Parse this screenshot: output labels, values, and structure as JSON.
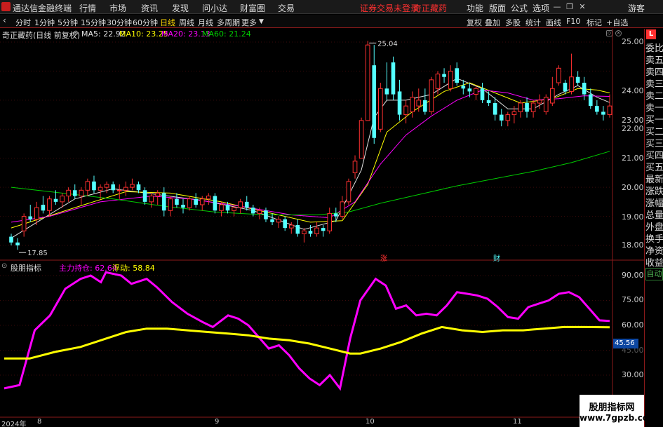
{
  "menubar": {
    "app_title": "通达信金融终端",
    "items": [
      "行情",
      "市场",
      "资讯",
      "发现",
      "问小达",
      "财富圈",
      "交易"
    ],
    "notice": "证券交易未登录",
    "stock_link": "奇正藏药",
    "right_items": [
      "功能",
      "版面",
      "公式",
      "选项"
    ],
    "user": "游客"
  },
  "toolbar": {
    "periods": [
      "分时",
      "1分钟",
      "5分钟",
      "15分钟",
      "30分钟",
      "60分钟",
      "日线",
      "周线",
      "月线",
      "多周期",
      "更多"
    ],
    "active_period": "日线",
    "right_items": [
      "复权",
      "叠加",
      "多股",
      "统计",
      "画线",
      "F10",
      "标记",
      "+自选"
    ]
  },
  "price_chart": {
    "stock_name": "奇正藏药(日线 前复权)",
    "ma5": "MA5: 22.92",
    "ma10": "MA10: 23.25",
    "ma20": "MA20: 23.13",
    "ma60": "MA60: 21.24",
    "high_label": "25.04",
    "low_label": "17.85",
    "axis_ticks": [
      "25.00",
      "24.00",
      "23.00",
      "22.00",
      "21.00",
      "20.00",
      "19.00",
      "18.00"
    ],
    "event_up": "涨",
    "event_fin": "财"
  },
  "indicator": {
    "name": "股朋指标",
    "main_label": "主力持仓: 62.64",
    "float_label": "浮动: 58.84",
    "axis_ticks": [
      "90.00",
      "75.00",
      "60.00",
      "45.00",
      "30.00"
    ],
    "current_value": "45.56"
  },
  "date_axis": [
    "2024年",
    "8",
    "9",
    "10",
    "11"
  ],
  "side_panel": {
    "badge": "L",
    "items": [
      "委比",
      "卖五",
      "卖四",
      "卖三",
      "卖二",
      "卖一",
      "买一",
      "买二",
      "买三",
      "买四",
      "买五",
      "最新",
      "涨跌",
      "涨幅",
      "总量",
      "外盘",
      "换手",
      "净资",
      "收益"
    ],
    "auto_label": "自动"
  },
  "watermark": {
    "line1": "股朋指标网",
    "line2": "www.7gpzb.com"
  },
  "colors": {
    "up": "#ff3030",
    "down": "#54ffff",
    "ma5": "#e0e0e0",
    "ma10": "#ffff00",
    "ma20": "#ff00ff",
    "ma60": "#00cc00",
    "main_line": "#ff00ff",
    "float_line": "#ffff00"
  },
  "chart_data": {
    "type": "candlestick",
    "price_axis": {
      "ylim": [
        17.7,
        25.25
      ]
    },
    "candles": [
      {
        "o": 18.3,
        "h": 18.4,
        "l": 18.0,
        "c": 18.1
      },
      {
        "o": 18.1,
        "h": 18.25,
        "l": 17.85,
        "c": 18.0
      },
      {
        "o": 18.5,
        "h": 19.1,
        "l": 18.3,
        "c": 19.0
      },
      {
        "o": 19.0,
        "h": 19.4,
        "l": 18.8,
        "c": 18.9
      },
      {
        "o": 18.9,
        "h": 19.5,
        "l": 18.7,
        "c": 19.3
      },
      {
        "o": 19.4,
        "h": 19.7,
        "l": 19.1,
        "c": 19.2
      },
      {
        "o": 19.2,
        "h": 19.7,
        "l": 19.0,
        "c": 19.6
      },
      {
        "o": 19.6,
        "h": 19.9,
        "l": 19.4,
        "c": 19.5
      },
      {
        "o": 19.5,
        "h": 19.8,
        "l": 19.3,
        "c": 19.7
      },
      {
        "o": 19.7,
        "h": 20.0,
        "l": 19.5,
        "c": 19.9
      },
      {
        "o": 19.9,
        "h": 20.1,
        "l": 19.6,
        "c": 19.7
      },
      {
        "o": 19.7,
        "h": 20.0,
        "l": 19.4,
        "c": 19.9
      },
      {
        "o": 19.9,
        "h": 20.3,
        "l": 19.7,
        "c": 20.2
      },
      {
        "o": 20.2,
        "h": 20.4,
        "l": 19.8,
        "c": 19.9
      },
      {
        "o": 19.9,
        "h": 20.1,
        "l": 19.6,
        "c": 20.0
      },
      {
        "o": 20.0,
        "h": 20.2,
        "l": 19.8,
        "c": 20.1
      },
      {
        "o": 20.1,
        "h": 20.2,
        "l": 19.8,
        "c": 19.9
      },
      {
        "o": 19.9,
        "h": 20.1,
        "l": 19.6,
        "c": 19.9
      },
      {
        "o": 19.9,
        "h": 20.2,
        "l": 19.7,
        "c": 20.0
      },
      {
        "o": 20.0,
        "h": 20.3,
        "l": 19.9,
        "c": 20.1
      },
      {
        "o": 20.1,
        "h": 20.2,
        "l": 19.8,
        "c": 19.9
      },
      {
        "o": 19.9,
        "h": 20.0,
        "l": 19.4,
        "c": 19.5
      },
      {
        "o": 19.5,
        "h": 19.8,
        "l": 19.3,
        "c": 19.7
      },
      {
        "o": 19.7,
        "h": 19.9,
        "l": 19.4,
        "c": 19.8
      },
      {
        "o": 19.8,
        "h": 20.0,
        "l": 19.0,
        "c": 19.2
      },
      {
        "o": 19.2,
        "h": 19.7,
        "l": 19.0,
        "c": 19.6
      },
      {
        "o": 19.6,
        "h": 19.8,
        "l": 19.3,
        "c": 19.4
      },
      {
        "o": 19.4,
        "h": 19.6,
        "l": 19.1,
        "c": 19.3
      },
      {
        "o": 19.3,
        "h": 19.7,
        "l": 19.2,
        "c": 19.6
      },
      {
        "o": 19.6,
        "h": 19.8,
        "l": 19.3,
        "c": 19.4
      },
      {
        "o": 19.4,
        "h": 19.7,
        "l": 19.2,
        "c": 19.6
      },
      {
        "o": 19.6,
        "h": 19.8,
        "l": 19.4,
        "c": 19.7
      },
      {
        "o": 19.7,
        "h": 19.8,
        "l": 19.1,
        "c": 19.2
      },
      {
        "o": 19.2,
        "h": 19.5,
        "l": 19.0,
        "c": 19.4
      },
      {
        "o": 19.4,
        "h": 19.5,
        "l": 19.1,
        "c": 19.2
      },
      {
        "o": 19.2,
        "h": 19.4,
        "l": 19.0,
        "c": 19.3
      },
      {
        "o": 19.3,
        "h": 19.6,
        "l": 19.1,
        "c": 19.5
      },
      {
        "o": 19.5,
        "h": 19.7,
        "l": 19.2,
        "c": 19.3
      },
      {
        "o": 19.3,
        "h": 19.4,
        "l": 19.0,
        "c": 19.1
      },
      {
        "o": 19.1,
        "h": 19.3,
        "l": 18.9,
        "c": 19.2
      },
      {
        "o": 19.2,
        "h": 19.3,
        "l": 18.8,
        "c": 18.9
      },
      {
        "o": 18.9,
        "h": 19.1,
        "l": 18.7,
        "c": 18.8
      },
      {
        "o": 18.8,
        "h": 19.0,
        "l": 18.6,
        "c": 18.9
      },
      {
        "o": 18.9,
        "h": 19.0,
        "l": 18.5,
        "c": 18.6
      },
      {
        "o": 18.6,
        "h": 18.8,
        "l": 18.4,
        "c": 18.7
      },
      {
        "o": 18.7,
        "h": 18.9,
        "l": 18.3,
        "c": 18.4
      },
      {
        "o": 18.4,
        "h": 18.6,
        "l": 18.1,
        "c": 18.5
      },
      {
        "o": 18.5,
        "h": 18.7,
        "l": 18.3,
        "c": 18.4
      },
      {
        "o": 18.4,
        "h": 18.8,
        "l": 18.3,
        "c": 18.6
      },
      {
        "o": 18.6,
        "h": 18.7,
        "l": 18.3,
        "c": 18.5
      },
      {
        "o": 18.5,
        "h": 19.3,
        "l": 18.4,
        "c": 19.1
      },
      {
        "o": 19.1,
        "h": 19.3,
        "l": 18.8,
        "c": 19.0
      },
      {
        "o": 19.0,
        "h": 19.7,
        "l": 18.9,
        "c": 19.5
      },
      {
        "o": 19.5,
        "h": 20.3,
        "l": 19.4,
        "c": 20.2
      },
      {
        "o": 20.5,
        "h": 21.1,
        "l": 20.3,
        "c": 20.9
      },
      {
        "o": 21.0,
        "h": 22.4,
        "l": 21.0,
        "c": 22.3
      },
      {
        "o": 22.3,
        "h": 25.04,
        "l": 22.3,
        "c": 24.9
      },
      {
        "o": 24.2,
        "h": 24.9,
        "l": 21.5,
        "c": 21.7
      },
      {
        "o": 22.0,
        "h": 23.6,
        "l": 21.9,
        "c": 23.4
      },
      {
        "o": 23.4,
        "h": 24.3,
        "l": 23.0,
        "c": 23.2
      },
      {
        "o": 24.3,
        "h": 24.5,
        "l": 23.0,
        "c": 23.2
      },
      {
        "o": 23.3,
        "h": 23.7,
        "l": 22.3,
        "c": 22.5
      },
      {
        "o": 22.5,
        "h": 23.0,
        "l": 22.2,
        "c": 22.8
      },
      {
        "o": 22.6,
        "h": 23.3,
        "l": 22.4,
        "c": 23.1
      },
      {
        "o": 22.8,
        "h": 23.4,
        "l": 22.6,
        "c": 23.0
      },
      {
        "o": 23.0,
        "h": 23.4,
        "l": 22.5,
        "c": 22.6
      },
      {
        "o": 22.6,
        "h": 23.8,
        "l": 22.5,
        "c": 23.7
      },
      {
        "o": 23.4,
        "h": 24.0,
        "l": 23.2,
        "c": 23.9
      },
      {
        "o": 23.9,
        "h": 24.1,
        "l": 23.6,
        "c": 23.8
      },
      {
        "o": 23.4,
        "h": 24.2,
        "l": 23.3,
        "c": 24.0
      },
      {
        "o": 24.1,
        "h": 24.3,
        "l": 23.5,
        "c": 23.6
      },
      {
        "o": 23.5,
        "h": 23.7,
        "l": 23.2,
        "c": 23.4
      },
      {
        "o": 23.4,
        "h": 23.6,
        "l": 23.1,
        "c": 23.3
      },
      {
        "o": 23.2,
        "h": 23.5,
        "l": 23.0,
        "c": 23.4
      },
      {
        "o": 23.4,
        "h": 23.6,
        "l": 22.9,
        "c": 23.0
      },
      {
        "o": 23.0,
        "h": 23.3,
        "l": 22.8,
        "c": 22.9
      },
      {
        "o": 22.9,
        "h": 23.1,
        "l": 22.3,
        "c": 22.5
      },
      {
        "o": 22.5,
        "h": 22.7,
        "l": 22.1,
        "c": 22.3
      },
      {
        "o": 22.3,
        "h": 22.6,
        "l": 22.1,
        "c": 22.5
      },
      {
        "o": 22.5,
        "h": 22.8,
        "l": 22.2,
        "c": 22.6
      },
      {
        "o": 22.6,
        "h": 23.0,
        "l": 22.4,
        "c": 22.9
      },
      {
        "o": 22.9,
        "h": 23.1,
        "l": 22.4,
        "c": 22.6
      },
      {
        "o": 22.6,
        "h": 23.0,
        "l": 22.4,
        "c": 22.9
      },
      {
        "o": 22.9,
        "h": 23.2,
        "l": 22.7,
        "c": 23.0
      },
      {
        "o": 22.6,
        "h": 23.2,
        "l": 22.5,
        "c": 23.1
      },
      {
        "o": 22.9,
        "h": 23.8,
        "l": 22.8,
        "c": 23.4
      },
      {
        "o": 23.6,
        "h": 24.2,
        "l": 23.5,
        "c": 24.1
      },
      {
        "o": 23.6,
        "h": 23.7,
        "l": 23.2,
        "c": 23.3
      },
      {
        "o": 23.3,
        "h": 24.6,
        "l": 23.2,
        "c": 23.8
      },
      {
        "o": 23.8,
        "h": 24.0,
        "l": 23.5,
        "c": 23.6
      },
      {
        "o": 23.6,
        "h": 23.8,
        "l": 23.0,
        "c": 23.2
      },
      {
        "o": 23.2,
        "h": 23.4,
        "l": 22.7,
        "c": 22.8
      },
      {
        "o": 22.8,
        "h": 23.0,
        "l": 22.5,
        "c": 22.6
      },
      {
        "o": 22.6,
        "h": 22.8,
        "l": 22.3,
        "c": 22.5
      },
      {
        "o": 22.5,
        "h": 23.2,
        "l": 22.4,
        "c": 22.8
      }
    ],
    "ma": {
      "ma5": [
        [
          0,
          18.25
        ],
        [
          10,
          19.6
        ],
        [
          16,
          19.95
        ],
        [
          23,
          19.75
        ],
        [
          30,
          19.55
        ],
        [
          38,
          19.2
        ],
        [
          46,
          18.55
        ],
        [
          51,
          18.85
        ],
        [
          55,
          20.6
        ],
        [
          57,
          22.4
        ],
        [
          59,
          23.0
        ],
        [
          62,
          23.0
        ],
        [
          66,
          23.2
        ],
        [
          70,
          23.75
        ],
        [
          74,
          23.4
        ],
        [
          78,
          22.7
        ],
        [
          82,
          22.7
        ],
        [
          86,
          23.2
        ],
        [
          89,
          23.5
        ],
        [
          92,
          23.1
        ],
        [
          94,
          22.92
        ]
      ],
      "ma10": [
        [
          0,
          18.6
        ],
        [
          10,
          19.3
        ],
        [
          18,
          19.85
        ],
        [
          25,
          19.8
        ],
        [
          33,
          19.5
        ],
        [
          40,
          19.15
        ],
        [
          47,
          18.8
        ],
        [
          52,
          18.85
        ],
        [
          56,
          20.1
        ],
        [
          59,
          21.9
        ],
        [
          63,
          22.6
        ],
        [
          68,
          23.3
        ],
        [
          72,
          23.6
        ],
        [
          76,
          23.25
        ],
        [
          80,
          22.9
        ],
        [
          85,
          23.05
        ],
        [
          89,
          23.4
        ],
        [
          92,
          23.35
        ],
        [
          94,
          23.25
        ]
      ],
      "ma20": [
        [
          0,
          18.8
        ],
        [
          6,
          19.0
        ],
        [
          14,
          19.5
        ],
        [
          22,
          19.7
        ],
        [
          28,
          19.6
        ],
        [
          36,
          19.35
        ],
        [
          44,
          19.05
        ],
        [
          50,
          18.95
        ],
        [
          54,
          19.5
        ],
        [
          58,
          20.8
        ],
        [
          62,
          21.8
        ],
        [
          66,
          22.45
        ],
        [
          70,
          23.0
        ],
        [
          74,
          23.35
        ],
        [
          78,
          23.25
        ],
        [
          82,
          23.0
        ],
        [
          86,
          23.05
        ],
        [
          90,
          23.15
        ],
        [
          94,
          23.13
        ]
      ],
      "ma60": [
        [
          0,
          20.0
        ],
        [
          8,
          19.8
        ],
        [
          16,
          19.6
        ],
        [
          24,
          19.35
        ],
        [
          32,
          19.15
        ],
        [
          40,
          19.05
        ],
        [
          48,
          19.05
        ],
        [
          53,
          19.15
        ],
        [
          58,
          19.45
        ],
        [
          64,
          19.75
        ],
        [
          70,
          20.05
        ],
        [
          76,
          20.3
        ],
        [
          82,
          20.55
        ],
        [
          88,
          20.85
        ],
        [
          94,
          21.24
        ]
      ]
    },
    "indicator_axis": {
      "ylim": [
        20,
        98
      ]
    },
    "main_position": [
      [
        0,
        22
      ],
      [
        3,
        24
      ],
      [
        6,
        57
      ],
      [
        9,
        66
      ],
      [
        12,
        82
      ],
      [
        15,
        88
      ],
      [
        17,
        90
      ],
      [
        19,
        86
      ],
      [
        20,
        92
      ],
      [
        23,
        90
      ],
      [
        25,
        85
      ],
      [
        28,
        88
      ],
      [
        30,
        83
      ],
      [
        33,
        74
      ],
      [
        36,
        67
      ],
      [
        39,
        62
      ],
      [
        41,
        59
      ],
      [
        44,
        66
      ],
      [
        46,
        64
      ],
      [
        48,
        60
      ],
      [
        50,
        53
      ],
      [
        52,
        46
      ],
      [
        54,
        48
      ],
      [
        56,
        42
      ],
      [
        58,
        34
      ],
      [
        60,
        28
      ],
      [
        62,
        24
      ],
      [
        64,
        30
      ],
      [
        66,
        22
      ],
      [
        68,
        52
      ],
      [
        70,
        75
      ],
      [
        73,
        88
      ],
      [
        75,
        84
      ],
      [
        77,
        70
      ],
      [
        79,
        72
      ],
      [
        81,
        66
      ],
      [
        83,
        67
      ],
      [
        85,
        66
      ],
      [
        87,
        72
      ],
      [
        89,
        80
      ],
      [
        91,
        79
      ],
      [
        93,
        78
      ],
      [
        95,
        76
      ],
      [
        97,
        71
      ],
      [
        99,
        65
      ],
      [
        101,
        64
      ],
      [
        103,
        71
      ],
      [
        105,
        73
      ],
      [
        107,
        75
      ],
      [
        109,
        79
      ],
      [
        111,
        80
      ],
      [
        113,
        77
      ],
      [
        115,
        70
      ],
      [
        117,
        63
      ],
      [
        119,
        62.64
      ]
    ],
    "float": [
      [
        0,
        40
      ],
      [
        5,
        40
      ],
      [
        10,
        44
      ],
      [
        15,
        47
      ],
      [
        20,
        52
      ],
      [
        24,
        56
      ],
      [
        28,
        58
      ],
      [
        32,
        58
      ],
      [
        36,
        57
      ],
      [
        40,
        56
      ],
      [
        44,
        55
      ],
      [
        48,
        54
      ],
      [
        52,
        52
      ],
      [
        56,
        51
      ],
      [
        60,
        49
      ],
      [
        64,
        46
      ],
      [
        68,
        43
      ],
      [
        70,
        43
      ],
      [
        74,
        46
      ],
      [
        78,
        50
      ],
      [
        82,
        55
      ],
      [
        86,
        59
      ],
      [
        90,
        57
      ],
      [
        94,
        56
      ],
      [
        98,
        57
      ],
      [
        102,
        57
      ],
      [
        106,
        58
      ],
      [
        110,
        59
      ],
      [
        114,
        59
      ],
      [
        119,
        58.84
      ]
    ]
  }
}
